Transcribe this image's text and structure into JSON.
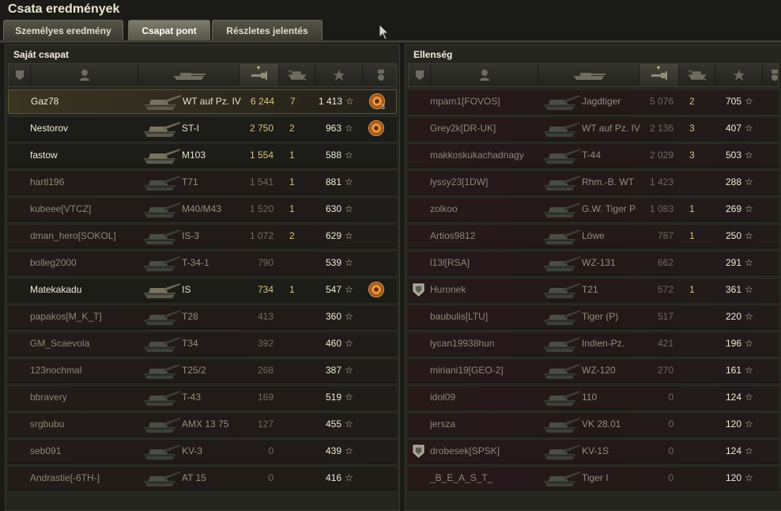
{
  "title": "Csata eredmények",
  "tabs": [
    {
      "label": "Személyes eredmény",
      "active": false
    },
    {
      "label": "Csapat pont",
      "active": true
    },
    {
      "label": "Részletes jelentés",
      "active": false
    }
  ],
  "teams": {
    "own": {
      "title": "Saját csapat",
      "players": [
        {
          "name": "Gaz78",
          "vehicle": "WT auf Pz. IV",
          "damage": "6 244",
          "frags": "7",
          "xp": "1 413",
          "alive": true,
          "me": true,
          "medal": true,
          "medal_count": "3"
        },
        {
          "name": "Nestorov",
          "vehicle": "ST-I",
          "damage": "2 750",
          "frags": "2",
          "xp": "963",
          "alive": true,
          "medal": true
        },
        {
          "name": "fastow",
          "vehicle": "M103",
          "damage": "1 554",
          "frags": "1",
          "xp": "588",
          "alive": true
        },
        {
          "name": "hartl196",
          "vehicle": "T71",
          "damage": "1 541",
          "frags": "1",
          "xp": "881",
          "alive": false
        },
        {
          "name": "kubeee[VTCZ]",
          "vehicle": "M40/M43",
          "damage": "1 520",
          "frags": "1",
          "xp": "630",
          "alive": false
        },
        {
          "name": "dman_hero[SOKOL]",
          "vehicle": "IS-3",
          "damage": "1 072",
          "frags": "2",
          "xp": "629",
          "alive": false
        },
        {
          "name": "bolleg2000",
          "vehicle": "T-34-1",
          "damage": "790",
          "frags": "",
          "xp": "539",
          "alive": false
        },
        {
          "name": "Matekakadu",
          "vehicle": "IS",
          "damage": "734",
          "frags": "1",
          "xp": "547",
          "alive": true,
          "medal": true
        },
        {
          "name": "papakos[M_K_T]",
          "vehicle": "T28",
          "damage": "413",
          "frags": "",
          "xp": "360",
          "alive": false
        },
        {
          "name": "GM_Scaevola",
          "vehicle": "T34",
          "damage": "392",
          "frags": "",
          "xp": "460",
          "alive": false
        },
        {
          "name": "123nochmal",
          "vehicle": "T25/2",
          "damage": "268",
          "frags": "",
          "xp": "387",
          "alive": false
        },
        {
          "name": "bbravery",
          "vehicle": "T-43",
          "damage": "169",
          "frags": "",
          "xp": "519",
          "alive": false
        },
        {
          "name": "srgbubu",
          "vehicle": "AMX 13 75",
          "damage": "127",
          "frags": "",
          "xp": "455",
          "alive": false
        },
        {
          "name": "seb091",
          "vehicle": "KV-3",
          "damage": "0",
          "frags": "",
          "xp": "439",
          "alive": false
        },
        {
          "name": "Andrastie[-6TH-]",
          "vehicle": "AT 15",
          "damage": "0",
          "frags": "",
          "xp": "416",
          "alive": false
        }
      ]
    },
    "enemy": {
      "title": "Ellenség",
      "players": [
        {
          "name": "mpam1[FOVOS]",
          "vehicle": "Jagdtiger",
          "damage": "5 076",
          "frags": "2",
          "xp": "705",
          "alive": false
        },
        {
          "name": "Grey2k[DR-UK]",
          "vehicle": "WT auf Pz. IV",
          "damage": "2 136",
          "frags": "3",
          "xp": "407",
          "alive": false
        },
        {
          "name": "makkoskukachadnagy",
          "vehicle": "T-44",
          "damage": "2 029",
          "frags": "3",
          "xp": "503",
          "alive": false
        },
        {
          "name": "lyssy23[1DW]",
          "vehicle": "Rhm.-B. WT",
          "damage": "1 423",
          "frags": "",
          "xp": "288",
          "alive": false
        },
        {
          "name": "zolkoo",
          "vehicle": "G.W. Tiger P",
          "damage": "1 083",
          "frags": "1",
          "xp": "269",
          "alive": false
        },
        {
          "name": "Artios9812",
          "vehicle": "Löwe",
          "damage": "787",
          "frags": "1",
          "xp": "250",
          "alive": false
        },
        {
          "name": "l13l[RSA]",
          "vehicle": "WZ-131",
          "damage": "662",
          "frags": "",
          "xp": "291",
          "alive": false
        },
        {
          "name": "Huronek",
          "vehicle": "T21",
          "damage": "572",
          "frags": "1",
          "xp": "361",
          "alive": false,
          "platoon": true
        },
        {
          "name": "baubulis[LTU]",
          "vehicle": "Tiger (P)",
          "damage": "517",
          "frags": "",
          "xp": "220",
          "alive": false
        },
        {
          "name": "lycan19938hun",
          "vehicle": "Indien-Pz.",
          "damage": "421",
          "frags": "",
          "xp": "196",
          "alive": false
        },
        {
          "name": "miriani19[GEO-2]",
          "vehicle": "WZ-120",
          "damage": "270",
          "frags": "",
          "xp": "161",
          "alive": false
        },
        {
          "name": "idol09",
          "vehicle": "110",
          "damage": "0",
          "frags": "",
          "xp": "124",
          "alive": false
        },
        {
          "name": "jersza",
          "vehicle": "VK 28.01",
          "damage": "0",
          "frags": "",
          "xp": "120",
          "alive": false
        },
        {
          "name": "drobesek[SPSK]",
          "vehicle": "KV-1S",
          "damage": "0",
          "frags": "",
          "xp": "124",
          "alive": false,
          "platoon": true
        },
        {
          "name": "_B_E_A_S_T_",
          "vehicle": "Tiger I",
          "damage": "0",
          "frags": "",
          "xp": "120",
          "alive": false
        }
      ]
    }
  },
  "star_glyph": "☆",
  "colors": {
    "highlight": "#5c5438",
    "damage": "#d7c37d",
    "dead_row": "#231b19"
  }
}
